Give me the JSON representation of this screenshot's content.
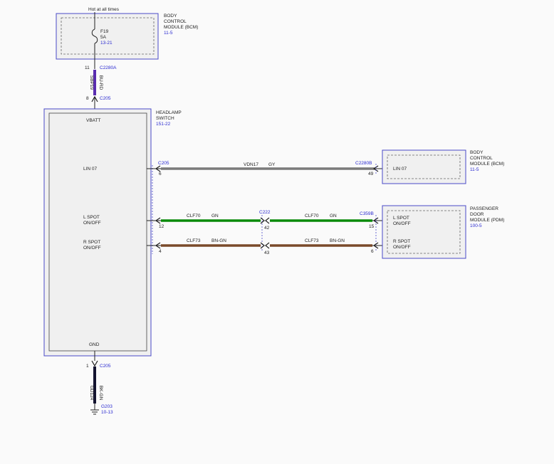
{
  "supply": {
    "label": "Hot at all times",
    "fuse_name": "F19",
    "fuse_rating": "5A",
    "fuse_ref": "13-21"
  },
  "bcm_top": {
    "name_line1": "BODY",
    "name_line2": "CONTROL",
    "name_line3": "MODULE (BCM)",
    "ref": "11-5"
  },
  "connectors": {
    "c2280a_pin": "11",
    "c2280a": "C2280A",
    "c205_top_pin": "8",
    "c205_top": "C205",
    "c205_lin": "C205",
    "c205_lin_pin": "6",
    "c205_lspot_pin": "12",
    "c205_rspot_pin": "4",
    "c222": "C222",
    "c222_l_pin": "42",
    "c222_r_pin": "43",
    "c2280b": "C2280B",
    "c2280b_pin": "49",
    "c359b": "C359B",
    "c359b_l_pin": "15",
    "c359b_r_pin": "6",
    "c205_bottom_pin": "1",
    "c205_bottom": "C205"
  },
  "wires": {
    "supply_circuit": "SBP19",
    "supply_color": "BU-RD",
    "lin_circuit": "VDN17",
    "lin_color": "GY",
    "lspot_circuit": "CLF70",
    "lspot_color": "GN",
    "rspot_circuit": "CLF73",
    "rspot_color": "BN-GN",
    "gnd_circuit": "GD124",
    "gnd_color": "BK-GN"
  },
  "headlamp_switch": {
    "name_line1": "HEADLAMP",
    "name_line2": "SWITCH",
    "ref": "151-22",
    "pin_vbatt": "VBATT",
    "pin_lin": "LIN 07",
    "pin_lspot_1": "L SPOT",
    "pin_lspot_2": "ON/OFF",
    "pin_rspot_1": "R SPOT",
    "pin_rspot_2": "ON/OFF",
    "pin_gnd": "GND"
  },
  "bcm_right": {
    "name_line1": "BODY",
    "name_line2": "CONTROL",
    "name_line3": "MODULE (BCM)",
    "ref": "11-5",
    "pin_lin": "LIN 07"
  },
  "pdm": {
    "name_line1": "PASSENGER",
    "name_line2": "DOOR",
    "name_line3": "MODULE (PDM)",
    "ref": "100-5",
    "pin_lspot_1": "L SPOT",
    "pin_lspot_2": "ON/OFF",
    "pin_rspot_1": "R SPOT",
    "pin_rspot_2": "ON/OFF"
  },
  "ground": {
    "name": "G203",
    "ref": "10-13"
  },
  "colors": {
    "outline": "#4a4ac8",
    "supply_wire": "#5a2db0",
    "lin_wire": "#7a7a7a",
    "lspot_wire": "#0a8a0a",
    "rspot_wire": "#7a4a2a",
    "gnd_wire": "#141430",
    "module_fill": "#f0f0f0"
  }
}
